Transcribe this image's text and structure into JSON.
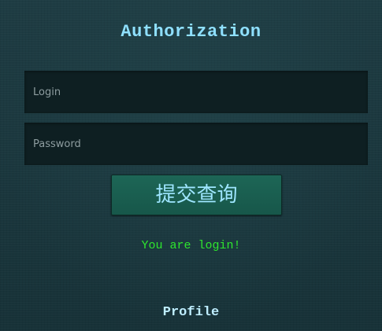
{
  "page": {
    "title": "Authorization"
  },
  "form": {
    "login_placeholder": "Login",
    "login_value": "",
    "password_placeholder": "Password",
    "password_value": "",
    "submit_label": "提交查询"
  },
  "status": {
    "message": "You are login!"
  },
  "footer": {
    "profile_label": "Profile"
  },
  "colors": {
    "background": "#1d3a40",
    "title": "#8fe0ff",
    "button": "#1d6656",
    "button_text": "#9ee6ff",
    "status_text": "#2ee62e",
    "profile_text": "#bfeeff"
  }
}
